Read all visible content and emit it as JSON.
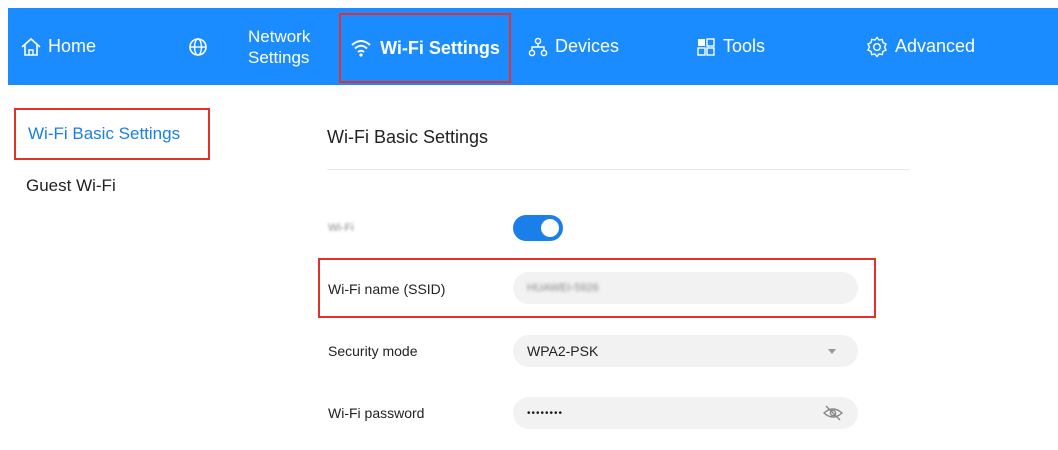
{
  "nav": {
    "home": "Home",
    "network": [
      "Network",
      "Settings"
    ],
    "wifi_settings": "Wi-Fi Settings",
    "devices": "Devices",
    "tools": "Tools",
    "advanced": "Advanced"
  },
  "sidebar": {
    "items": [
      {
        "label": "Wi-Fi Basic Settings",
        "active": true
      },
      {
        "label": "Guest Wi-Fi",
        "active": false
      }
    ]
  },
  "main": {
    "title": "Wi-Fi Basic Settings",
    "wifi_label": "Wi-Fi",
    "wifi_enabled": true,
    "ssid_label": "Wi-Fi name (SSID)",
    "ssid_value": "HUAWEI-5926",
    "security_label": "Security mode",
    "security_value": "WPA2-PSK",
    "password_label": "Wi-Fi password",
    "password_value": "••••••••"
  },
  "colors": {
    "accent": "#1a8cff",
    "highlight": "#e0312f",
    "active_text": "#1a7fe8"
  }
}
